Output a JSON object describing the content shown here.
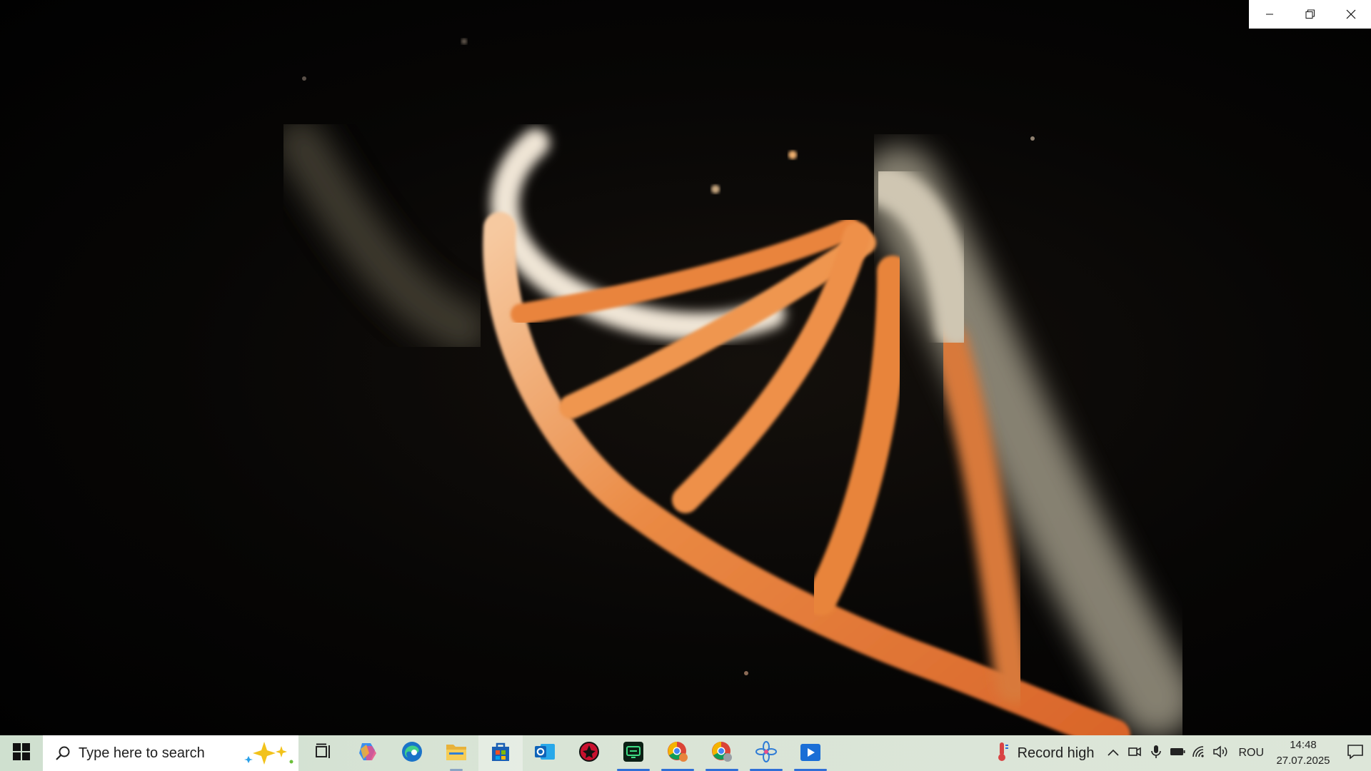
{
  "window": {
    "minimize_icon": "minimize-icon",
    "restore_icon": "restore-icon",
    "close_icon": "close-icon"
  },
  "video": {
    "subject": "dna-helix-frame",
    "colors": {
      "strand": "#e8843c",
      "strand_light": "#f4b684",
      "pale_strand": "#e6ddd0",
      "background": "#050403"
    }
  },
  "taskbar": {
    "search_placeholder": "Type here to search",
    "apps": [
      {
        "icon": "task-view-icon"
      },
      {
        "icon": "copilot-icon"
      },
      {
        "icon": "edge-icon"
      },
      {
        "icon": "file-explorer-icon"
      },
      {
        "icon": "microsoft-store-icon"
      },
      {
        "icon": "outlook-icon"
      },
      {
        "icon": "app-red-icon"
      },
      {
        "icon": "terminal-app-icon"
      },
      {
        "icon": "chrome-profile-icon"
      },
      {
        "icon": "chrome-icon"
      },
      {
        "icon": "pinwheel-app-icon"
      },
      {
        "icon": "media-player-icon"
      }
    ],
    "weather_text": "Record high",
    "language": "ROU",
    "time": "14:48",
    "date": "27.07.2025"
  }
}
